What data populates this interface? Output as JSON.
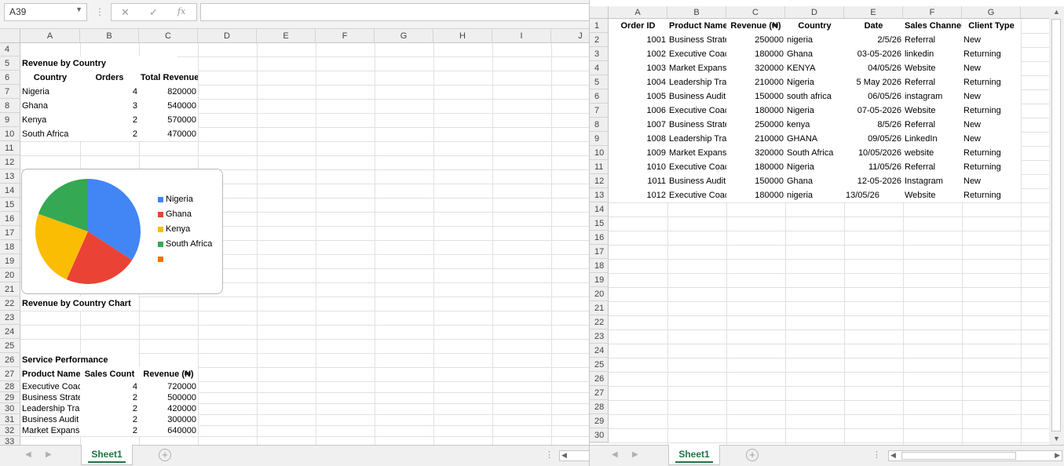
{
  "left_pane": {
    "name_box": "A39",
    "formula": "",
    "icons": {
      "cancel": "✕",
      "enter": "✓",
      "function": "fx"
    },
    "columns": [
      "A",
      "B",
      "C",
      "D",
      "E",
      "F",
      "G",
      "H",
      "I",
      "J"
    ],
    "rows": [
      "4",
      "5",
      "6",
      "7",
      "8",
      "9",
      "10",
      "11",
      "12",
      "13",
      "14",
      "15",
      "16",
      "17",
      "18",
      "19",
      "20",
      "21",
      "22",
      "23",
      "24",
      "25",
      "26",
      "27",
      "28",
      "29",
      "30",
      "31",
      "32",
      "33"
    ],
    "revenue_by_country": {
      "title": "Revenue by Country",
      "headers": [
        "Country",
        "Orders",
        "Total Revenue (₦)"
      ],
      "rows": [
        [
          "Nigeria",
          "4",
          "820000"
        ],
        [
          "Ghana",
          "3",
          "540000"
        ],
        [
          "Kenya",
          "2",
          "570000"
        ],
        [
          "South Africa",
          "2",
          "470000"
        ]
      ]
    },
    "chart_label": "Revenue by Country Chart",
    "service_performance": {
      "title": "Service Performance",
      "headers": [
        "Product Name",
        "Sales Count",
        "Revenue (₦)"
      ],
      "rows": [
        [
          "Executive Coaching",
          "4",
          "720000"
        ],
        [
          "Business Strategy",
          "2",
          "500000"
        ],
        [
          "Leadership Training",
          "2",
          "420000"
        ],
        [
          "Business Audit",
          "2",
          "300000"
        ],
        [
          "Market Expansion",
          "2",
          "640000"
        ]
      ]
    },
    "sheet_tab": "Sheet1"
  },
  "chart_data": {
    "type": "pie",
    "categories": [
      "Nigeria",
      "Ghana",
      "Kenya",
      "South Africa",
      ""
    ],
    "values": [
      820000,
      540000,
      570000,
      470000,
      0
    ],
    "colors": [
      "#4285f4",
      "#ea4335",
      "#fbbc04",
      "#34a853",
      "#ff6d01"
    ],
    "legend": "right"
  },
  "right_pane": {
    "columns": [
      "A",
      "B",
      "C",
      "D",
      "E",
      "F",
      "G"
    ],
    "rows": [
      "1",
      "2",
      "3",
      "4",
      "5",
      "6",
      "7",
      "8",
      "9",
      "10",
      "11",
      "12",
      "13",
      "14",
      "15",
      "16",
      "17",
      "18",
      "19",
      "20",
      "21",
      "22",
      "23",
      "24",
      "25",
      "26",
      "27",
      "28",
      "29",
      "30"
    ],
    "headers": [
      "Order ID",
      "Product Name",
      "Revenue (₦)",
      "Country",
      "Date",
      "Sales Channel",
      "Client Type"
    ],
    "data": [
      [
        "1001",
        "Business Strategy",
        "250000",
        "nigeria",
        "2/5/26",
        "Referral",
        "New"
      ],
      [
        "1002",
        "Executive Coaching",
        "180000",
        "Ghana",
        "03-05-2026",
        "linkedin",
        "Returning"
      ],
      [
        "1003",
        "Market Expansion",
        "320000",
        "KENYA",
        "04/05/26",
        "Website",
        "New"
      ],
      [
        "1004",
        "Leadership Training",
        "210000",
        "Nigeria",
        "5 May 2026",
        "Referral",
        "Returning"
      ],
      [
        "1005",
        "Business Audit",
        "150000",
        "south africa",
        "06/05/26",
        "instagram",
        "New"
      ],
      [
        "1006",
        "Executive Coaching",
        "180000",
        "Nigeria",
        "07-05-2026",
        "Website",
        "Returning"
      ],
      [
        "1007",
        "Business Strategy",
        "250000",
        "kenya",
        "8/5/26",
        "Referral",
        "New"
      ],
      [
        "1008",
        "Leadership Training",
        "210000",
        "GHANA",
        "09/05/26",
        "LinkedIn",
        "New"
      ],
      [
        "1009",
        "Market Expansion",
        "320000",
        "South Africa",
        "10/05/2026",
        "website",
        "Returning"
      ],
      [
        "1010",
        "Executive Coaching",
        "180000",
        "Nigeria",
        "11/05/26",
        "Referral",
        "Returning"
      ],
      [
        "1011",
        "Business Audit",
        "150000",
        "Ghana",
        "12-05-2026",
        "Instagram",
        "New"
      ],
      [
        "1012",
        "Executive Coaching",
        "180000",
        "nigeria",
        "13/05/26",
        "Website",
        "Returning"
      ]
    ],
    "sheet_tab": "Sheet1"
  }
}
